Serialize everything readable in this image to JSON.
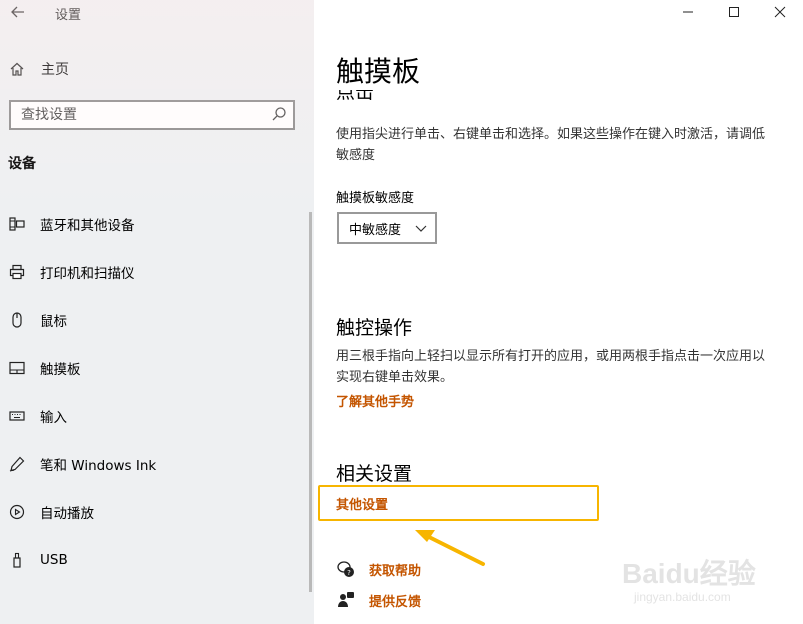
{
  "window": {
    "title": "设置"
  },
  "sidebar": {
    "home_label": "主页",
    "search_placeholder": "查找设置",
    "section_title": "设备",
    "items": [
      {
        "label": "蓝牙和其他设备",
        "icon": "bluetooth-devices-icon"
      },
      {
        "label": "打印机和扫描仪",
        "icon": "printer-icon"
      },
      {
        "label": "鼠标",
        "icon": "mouse-icon"
      },
      {
        "label": "触摸板",
        "icon": "touchpad-icon"
      },
      {
        "label": "输入",
        "icon": "keyboard-icon"
      },
      {
        "label": "笔和 Windows Ink",
        "icon": "pen-icon"
      },
      {
        "label": "自动播放",
        "icon": "autoplay-icon"
      },
      {
        "label": "USB",
        "icon": "usb-icon"
      }
    ]
  },
  "main": {
    "page_title": "触摸板",
    "clipped_heading": "点击",
    "tap_description": "使用指尖进行单击、右键单击和选择。如果这些操作在键入时激活，请调低敏感度",
    "sensitivity_label": "触摸板敏感度",
    "sensitivity_value": "中敏感度",
    "gestures_heading": "触控操作",
    "gestures_description": "用三根手指向上轻扫以显示所有打开的应用，或用两根手指点击一次应用以实现右键单击效果。",
    "gestures_link": "了解其他手势",
    "related_heading": "相关设置",
    "related_link": "其他设置",
    "help_label": "获取帮助",
    "feedback_label": "提供反馈"
  },
  "watermark": {
    "brand": "Baidu经验",
    "url": "jingyan.baidu.com"
  },
  "colors": {
    "accent_link": "#c45500",
    "highlight": "#f7b500",
    "sidebar_bg": "#eef0f2"
  }
}
